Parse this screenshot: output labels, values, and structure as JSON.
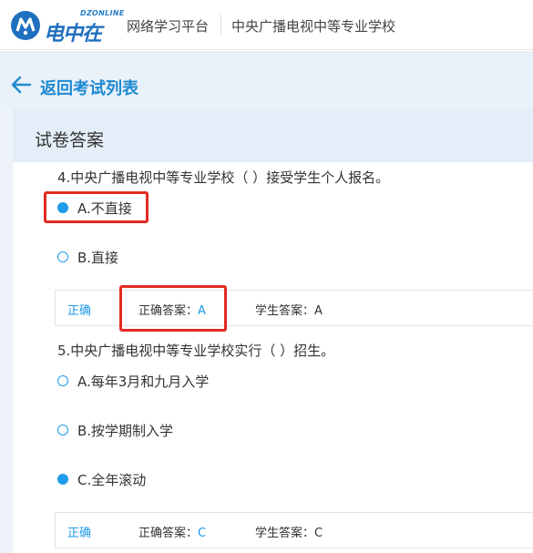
{
  "header": {
    "logo_en": "DZONLINE",
    "logo_cn": "电中在线",
    "platform_link": "网络学习平台",
    "school_link": "中央广播电视中等专业学校"
  },
  "nav": {
    "back_label": "返回考试列表"
  },
  "panel": {
    "title": "试卷答案"
  },
  "questions": [
    {
      "text": "4.中央广播电视中等专业学校（  ）接受学生个人报名。",
      "options": [
        {
          "label": "A.不直接",
          "selected": true
        },
        {
          "label": "B.直接",
          "selected": false
        }
      ],
      "result": {
        "status": "正确",
        "correct_label": "正确答案：",
        "correct_value": "A",
        "student_label": "学生答案：A"
      }
    },
    {
      "text": "5.中央广播电视中等专业学校实行（  ）招生。",
      "options": [
        {
          "label": "A.每年3月和九月入学",
          "selected": false
        },
        {
          "label": "B.按学期制入学",
          "selected": false
        },
        {
          "label": "C.全年滚动",
          "selected": true
        }
      ],
      "result": {
        "status": "正确",
        "correct_label": "正确答案：",
        "correct_value": "C",
        "student_label": "学生答案：C"
      }
    }
  ],
  "colors": {
    "accent": "#1e9be8",
    "highlight_box": "#e32a21",
    "back_bar_bg": "#e9f1f9",
    "title_bar_bg": "#e4eef8"
  }
}
